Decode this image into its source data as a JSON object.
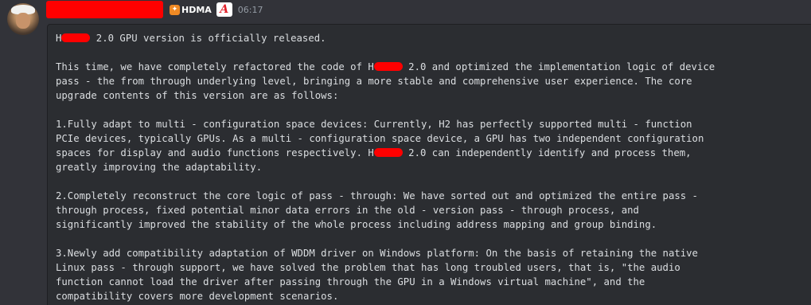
{
  "message": {
    "avatar_icon": "user-avatar",
    "badge_label": "HDMA",
    "badge_icon": "hdma-icon",
    "logo_letter": "A",
    "timestamp": "06:17",
    "accent_redaction": "#ff0000"
  },
  "content": {
    "title_a": "H",
    "title_b": " 2.0 GPU version is officially released.",
    "intro_1a": "This time, we have completely refactored the code of H",
    "intro_1b": " 2.0 and optimized the implementation logic of device",
    "intro_2": "pass - the from through underlying level, bringing a more stable and comprehensive user experience. The core",
    "intro_3": "upgrade contents of this version are as follows:",
    "p1_1": "1.Fully adapt to multi - configuration space devices: Currently, H2 has perfectly supported multi - function",
    "p1_2": "PCIe devices, typically GPUs. As a multi - configuration space device, a GPU has two independent configuration",
    "p1_3a": "spaces for display and audio functions respectively. H",
    "p1_3b": " 2.0 can independently identify and process them,",
    "p1_4": "greatly improving the adaptability.",
    "p2_1": "2.Completely reconstruct the core logic of pass - through: We have sorted out and optimized the entire pass -",
    "p2_2": "through process, fixed potential minor data errors in the old - version pass - through process, and",
    "p2_3": "significantly improved the stability of the whole process including address mapping and group binding.",
    "p3_1": "3.Newly add compatibility adaptation of WDDM driver on Windows platform: On the basis of retaining the native",
    "p3_2": "Linux pass - through support, we have solved the problem that has long troubled users, that is, \"the audio",
    "p3_3": "function cannot load the driver after passing through the GPU in a Windows virtual machine\", and the",
    "p3_4": "compatibility covers more development scenarios."
  }
}
